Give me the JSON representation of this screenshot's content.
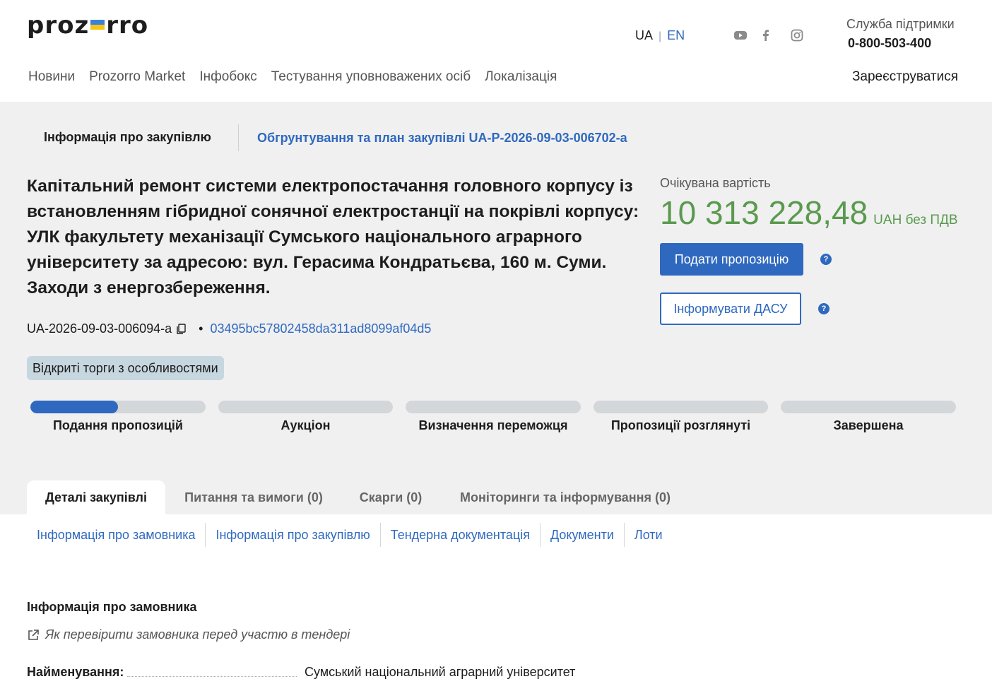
{
  "header": {
    "logo_text_left": "proz",
    "logo_text_right": "rro",
    "lang_ua": "UA",
    "lang_en": "EN",
    "support_title": "Служба підтримки",
    "support_phone": "0-800-503-400",
    "nav": [
      "Новини",
      "Prozorro Market",
      "Інфобокс",
      "Тестування уповноважених осіб",
      "Локалізація"
    ],
    "register": "Зареєструватися"
  },
  "procurement": {
    "info_tab": "Інформація про закупівлю",
    "plan_link": "Обгрунтування та план закупівлі UA-P-2026-09-03-006702-a",
    "title": "Капітальний ремонт системи електропостачання головного корпусу із встановленням гібридної сонячної електростанції на покрівлі корпусу: УЛК факультету механізації Сумського національного аграрного університету за адресою: вул. Герасима Кондратьєва, 160 м. Суми. Заходи з енергозбереження.",
    "expected_label": "Очікувана вартість",
    "amount": "10 313 228,48",
    "currency": "UAH без ПДВ",
    "submit_button": "Подати пропозицію",
    "inform_button": "Інформувати ДАСУ",
    "tender_id": "UA-2026-09-03-006094-a",
    "hash": "03495bc57802458da311ad8099af04d5",
    "type_badge": "Відкриті торги з особливостями",
    "stages": [
      {
        "label": "Подання пропозицій",
        "progress": 0.5
      },
      {
        "label": "Аукціон",
        "progress": 0
      },
      {
        "label": "Визначення переможця",
        "progress": 0
      },
      {
        "label": "Пропозиції розглянуті",
        "progress": 0
      },
      {
        "label": "Завершена",
        "progress": 0
      }
    ]
  },
  "tabs": [
    "Деталі закупівлі",
    "Питання та вимоги (0)",
    "Скарги (0)",
    "Моніторинги та інформування (0)"
  ],
  "subnav": [
    "Інформація про замовника",
    "Інформація про закупівлю",
    "Тендерна документація",
    "Документи",
    "Лоти"
  ],
  "customer": {
    "section_title": "Інформація про замовника",
    "verify_link": "Як перевірити замовника перед участю в тендері",
    "name_label": "Найменування:",
    "name_value": "Сумський національний аграрний університет"
  },
  "colors": {
    "accent": "#2f69bf",
    "amount": "#5a9a4f",
    "gray_bg": "#f0f0f0",
    "badge": "#c7d7e0"
  }
}
